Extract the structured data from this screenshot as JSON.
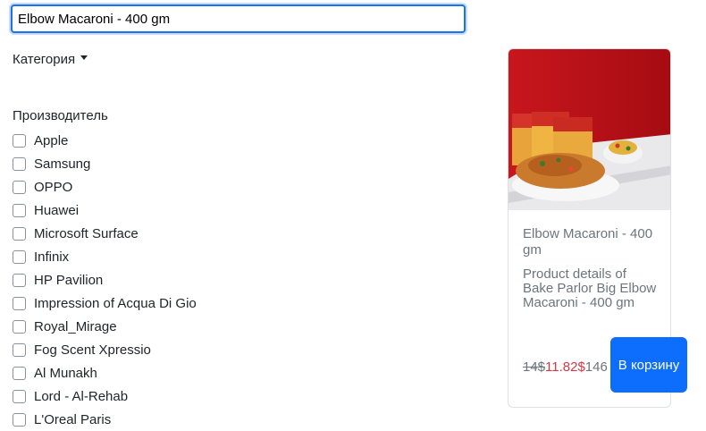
{
  "search": {
    "value": "Elbow Macaroni - 400 gm"
  },
  "filters": {
    "category_label": "Категория",
    "manufacturer_title": "Производитель",
    "manufacturers": [
      "Apple",
      "Samsung",
      "OPPO",
      "Huawei",
      "Microsoft Surface",
      "Infinix",
      "HP Pavilion",
      "Impression of Acqua Di Gio",
      "Royal_Mirage",
      "Fog Scent Xpressio",
      "Al Munakh",
      "Lord - Al-Rehab",
      "L'Oreal Paris"
    ]
  },
  "product": {
    "title": "Elbow Macaroni - 400 gm",
    "description": "Product details of Bake Parlor Big Elbow Macaroni - 400 gm",
    "old_price": "14$",
    "new_price": "11.82$",
    "base_price": "146",
    "cart_button": "В корзину"
  },
  "colors": {
    "accent": "#0d6efd",
    "sale": "#dc3545",
    "muted": "#6c757d"
  }
}
